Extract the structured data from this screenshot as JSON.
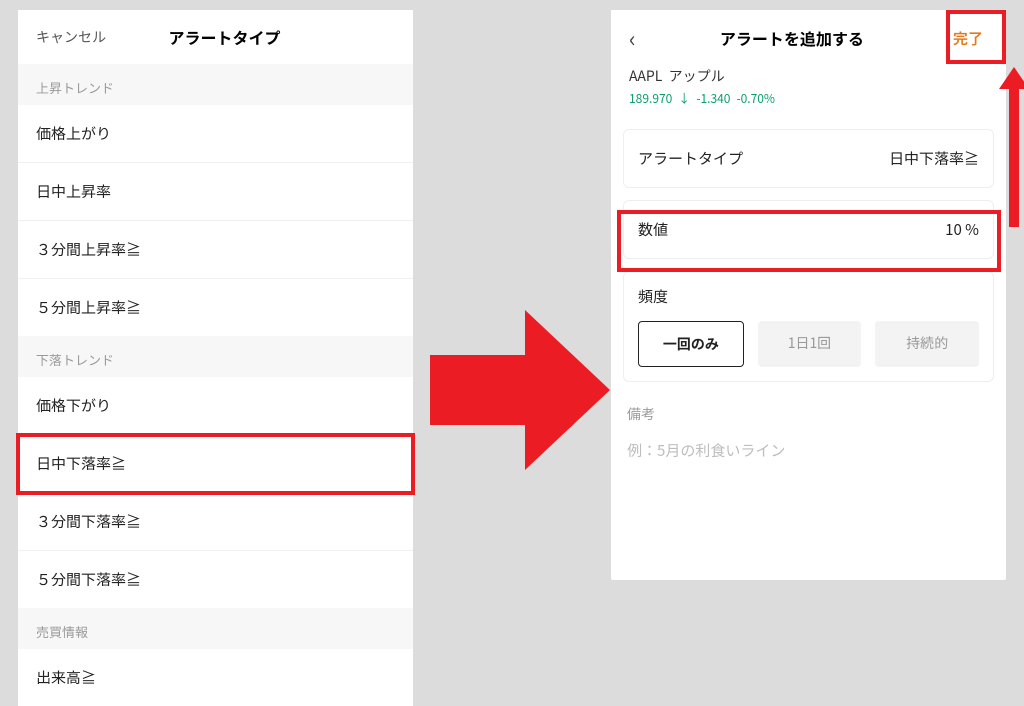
{
  "left": {
    "cancel": "キャンセル",
    "title": "アラートタイプ",
    "sections": [
      {
        "label": "上昇トレンド",
        "items": [
          "価格上がり",
          "日中上昇率",
          "３分間上昇率≧",
          "５分間上昇率≧"
        ]
      },
      {
        "label": "下落トレンド",
        "items": [
          "価格下がり",
          "日中下落率≧",
          "３分間下落率≧",
          "５分間下落率≧"
        ]
      },
      {
        "label": "売買情報",
        "items": [
          "出来高≧"
        ]
      }
    ]
  },
  "right": {
    "title": "アラートを追加する",
    "done": "完了",
    "ticker": {
      "symbol": "AAPL",
      "name": "アップル",
      "price": "189.970",
      "change": "-1.340",
      "pct": "-0.70%"
    },
    "rows": {
      "alertType": {
        "label": "アラートタイプ",
        "value": "日中下落率≧"
      },
      "value": {
        "label": "数値",
        "value": "10 %"
      }
    },
    "freq": {
      "label": "頻度",
      "options": [
        "一回のみ",
        "1日1回",
        "持続的"
      ]
    },
    "memo": {
      "label": "備考",
      "placeholder": "例：5月の利食いライン"
    }
  }
}
